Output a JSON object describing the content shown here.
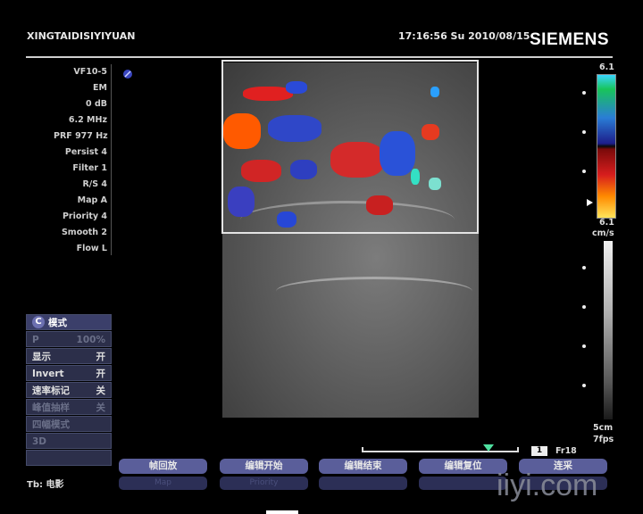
{
  "header": {
    "hospital": "XINGTAIDISIYIYUAN",
    "datetime": "17:16:56  Su  2010/08/15",
    "brand": "SIEMENS"
  },
  "params": [
    "VF10-5",
    "EM",
    "0 dB",
    "6.2 MHz",
    "PRF 977 Hz",
    "Persist 4",
    "Filter 1",
    "R/S 4",
    "Map A",
    "Priority 4",
    "Smooth 2",
    "Flow L"
  ],
  "color_scale": {
    "top": "6.1",
    "bottom": "6.1",
    "unit": "cm/s"
  },
  "depth": {
    "label": "5cm",
    "fps": "7fps"
  },
  "menu": {
    "title": "模式",
    "badge": "C",
    "rows": [
      {
        "label": "P",
        "value": "100%",
        "state": "dim"
      },
      {
        "label": "显示",
        "value": "开",
        "state": "lite"
      },
      {
        "label": "Invert",
        "value": "开",
        "state": "lite"
      },
      {
        "label": "速率标记",
        "value": "关",
        "state": "lite"
      },
      {
        "label": "峰值抽样",
        "value": "关",
        "state": "dim"
      },
      {
        "label": "四幅模式",
        "value": "",
        "state": "dim"
      },
      {
        "label": "3D",
        "value": "",
        "state": "dim"
      },
      {
        "label": "",
        "value": "",
        "state": "dim"
      }
    ]
  },
  "tb_label": "Tb: 电影",
  "softkeys": [
    "帧回放",
    "编辑开始",
    "编辑结束",
    "编辑复位",
    "连采"
  ],
  "softkeys_row2": [
    "Map",
    "Priority",
    "",
    "",
    ""
  ],
  "frame": {
    "box": "1",
    "label": "Fr18"
  },
  "watermark": "iiyi.com",
  "colors": {
    "accent": "#5a5e9a",
    "menu_bg": "#2c2f4a"
  }
}
